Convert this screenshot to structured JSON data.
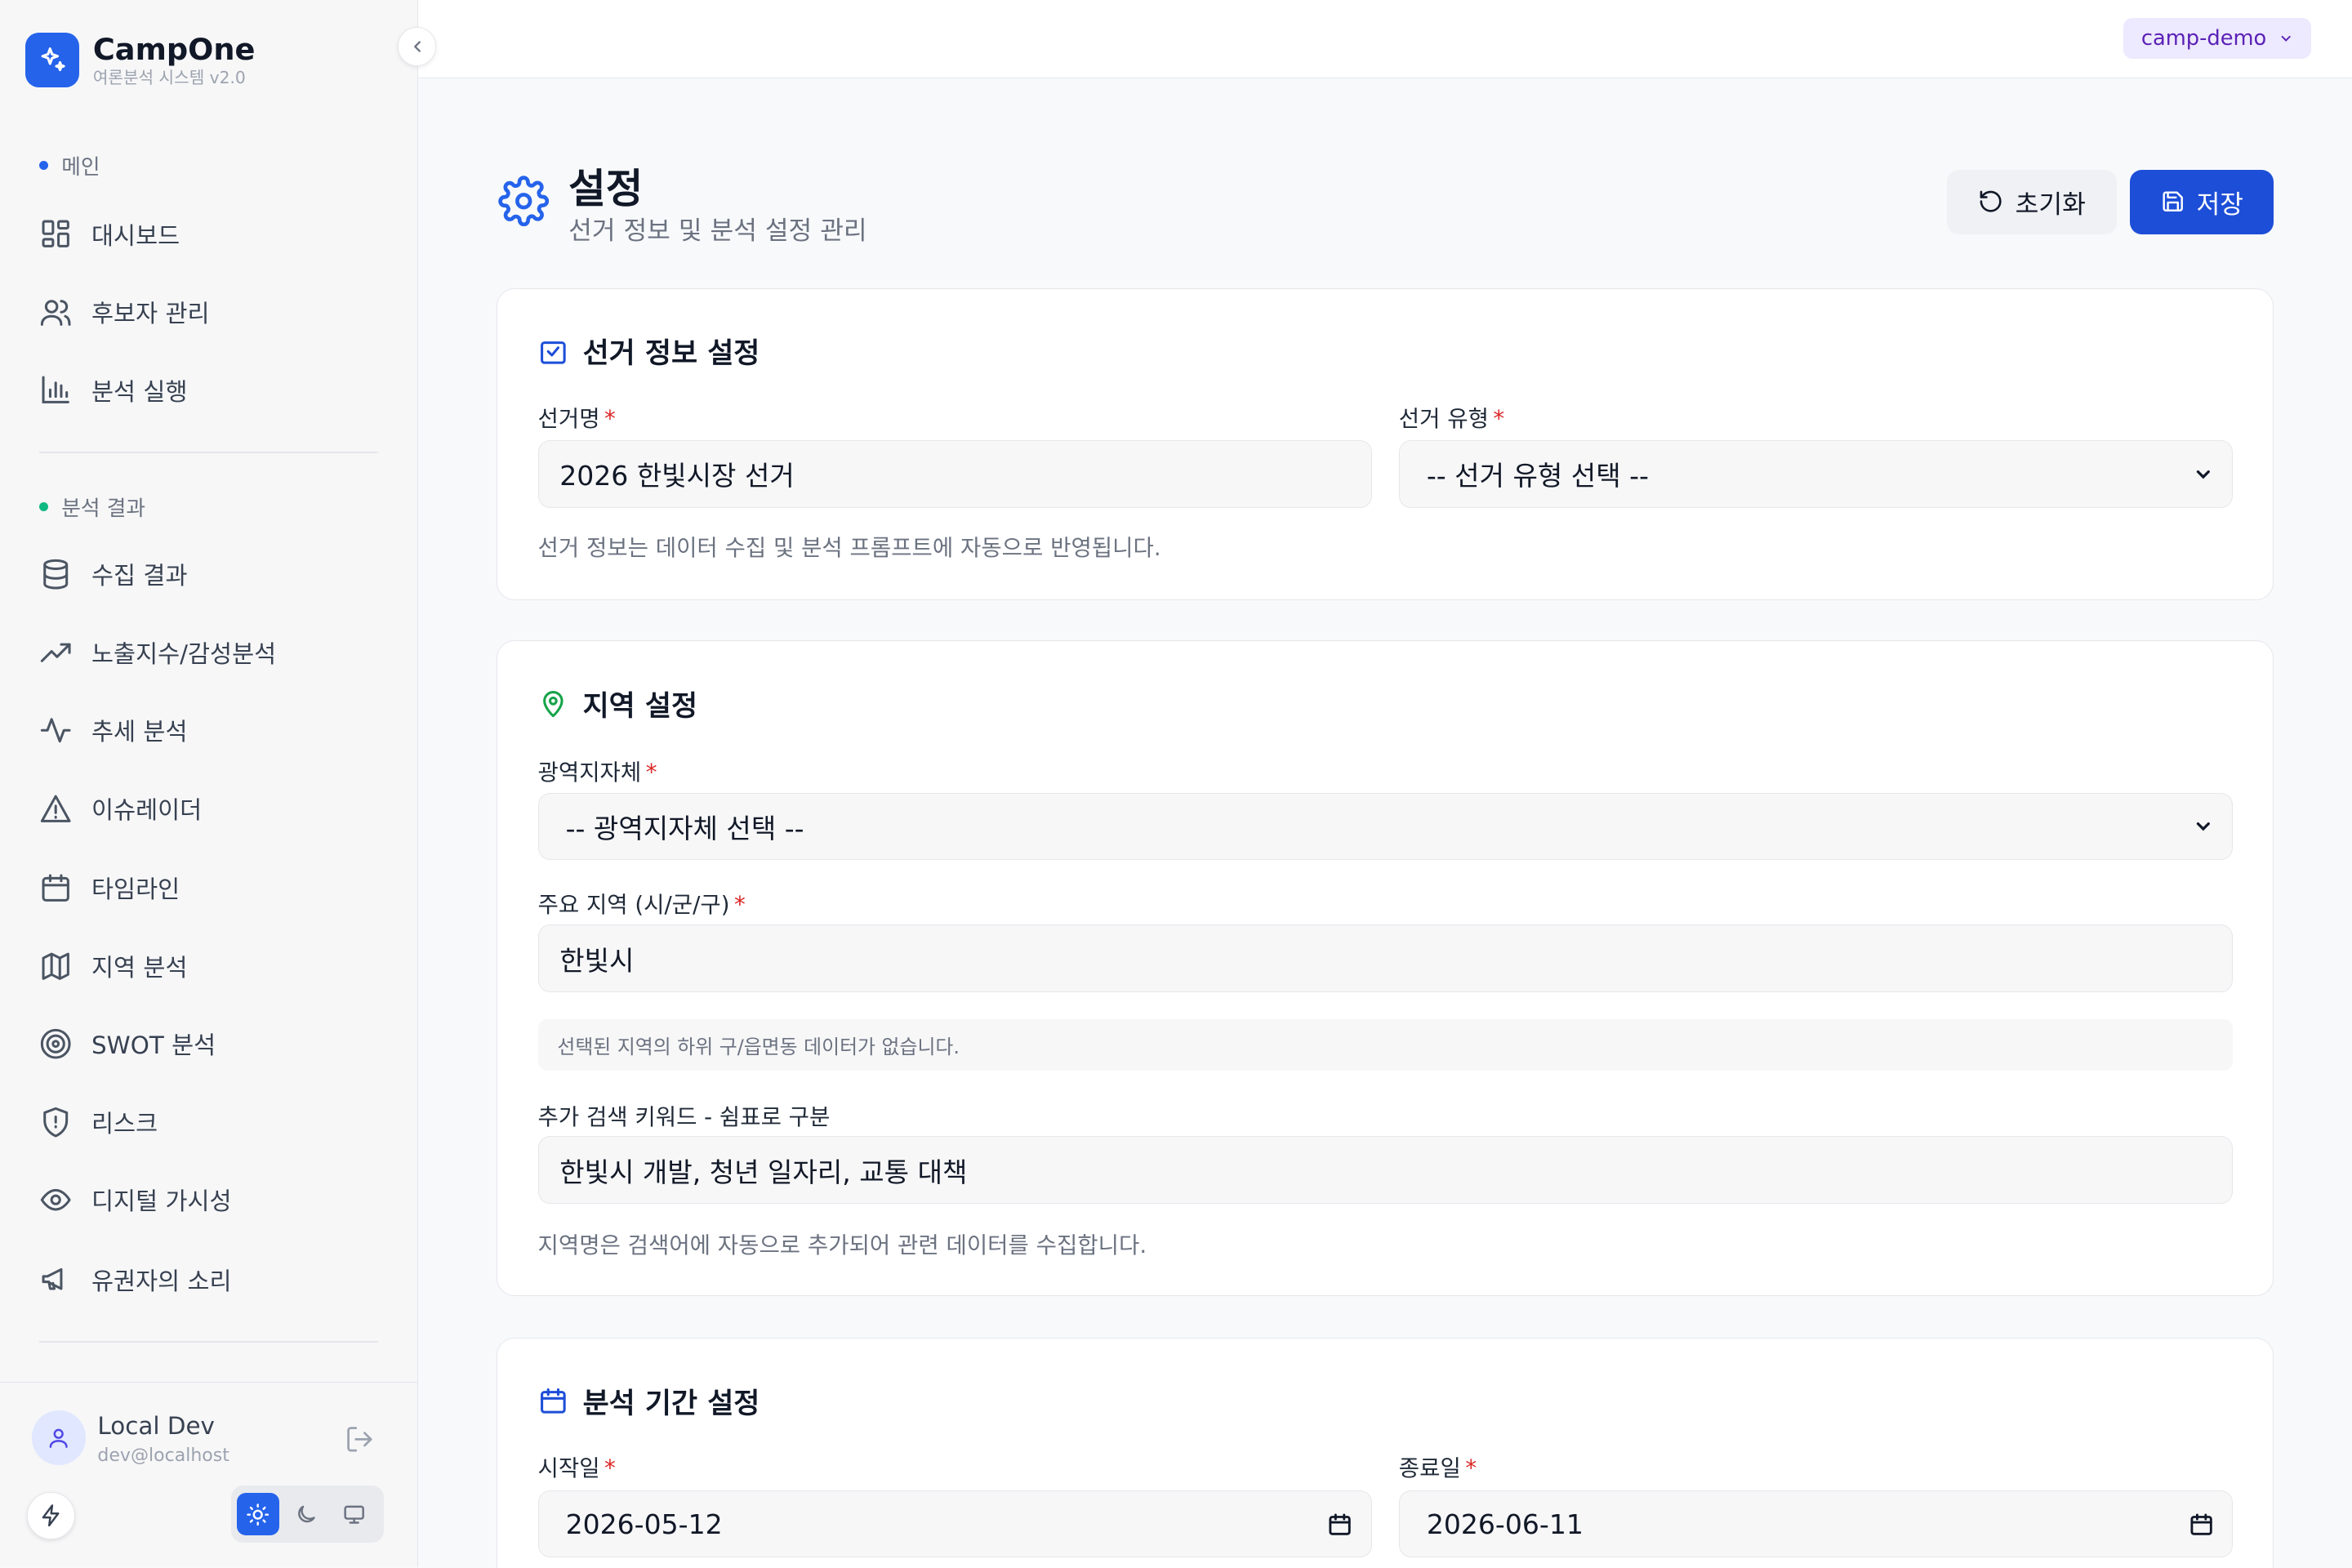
{
  "brand": {
    "name": "CampOne",
    "subtitle": "여론분석 시스템 v2.0"
  },
  "sidebar": {
    "section_main": "메인",
    "main_items": [
      {
        "label": "대시보드",
        "icon": "grid-icon"
      },
      {
        "label": "후보자 관리",
        "icon": "users-icon"
      },
      {
        "label": "분석 실행",
        "icon": "bar-chart-icon"
      }
    ],
    "section_results": "분석 결과",
    "result_items": [
      {
        "label": "수집 결과",
        "icon": "database-icon"
      },
      {
        "label": "노출지수/감성분석",
        "icon": "trending-up-icon"
      },
      {
        "label": "추세 분석",
        "icon": "activity-icon"
      },
      {
        "label": "이슈레이더",
        "icon": "alert-triangle-icon"
      },
      {
        "label": "타임라인",
        "icon": "calendar-icon"
      },
      {
        "label": "지역 분석",
        "icon": "map-icon"
      },
      {
        "label": "SWOT 분석",
        "icon": "target-icon"
      },
      {
        "label": "리스크",
        "icon": "shield-alert-icon"
      },
      {
        "label": "디지털 가시성",
        "icon": "eye-icon"
      },
      {
        "label": "유권자의 소리",
        "icon": "megaphone-icon"
      }
    ],
    "accent_main": "#2563eb",
    "accent_results": "#10b981"
  },
  "user": {
    "name": "Local Dev",
    "email": "dev@localhost"
  },
  "topbar": {
    "tenant": "camp-demo"
  },
  "page": {
    "title": "설정",
    "subtitle": "선거 정보 및 분석 설정 관리",
    "reset_label": "초기화",
    "save_label": "저장"
  },
  "election_card": {
    "title": "선거 정보 설정",
    "name_label": "선거명",
    "name_value": "2026 한빛시장 선거",
    "type_label": "선거 유형",
    "type_value": "-- 선거 유형 선택 --",
    "help": "선거 정보는 데이터 수집 및 분석 프롬프트에 자동으로 반영됩니다."
  },
  "region_card": {
    "title": "지역 설정",
    "province_label": "광역지자체",
    "province_value": "-- 광역지자체 선택 --",
    "city_label": "주요 지역 (시/군/구)",
    "city_value": "한빛시",
    "notice": "선택된 지역의 하위 구/읍면동 데이터가 없습니다.",
    "keywords_label": "추가 검색 키워드 - 쉼표로 구분",
    "keywords_value": "한빛시 개발, 청년 일자리, 교통 대책",
    "help": "지역명은 검색어에 자동으로 추가되어 관련 데이터를 수집합니다."
  },
  "period_card": {
    "title": "분석 기간 설정",
    "start_label": "시작일",
    "start_value": "2026-05-12",
    "end_label": "종료일",
    "end_value": "2026-06-11"
  },
  "colors": {
    "primary": "#2563eb",
    "save": "#1d4ed8",
    "required": "#dc2626",
    "region_icon": "#16a34a"
  }
}
